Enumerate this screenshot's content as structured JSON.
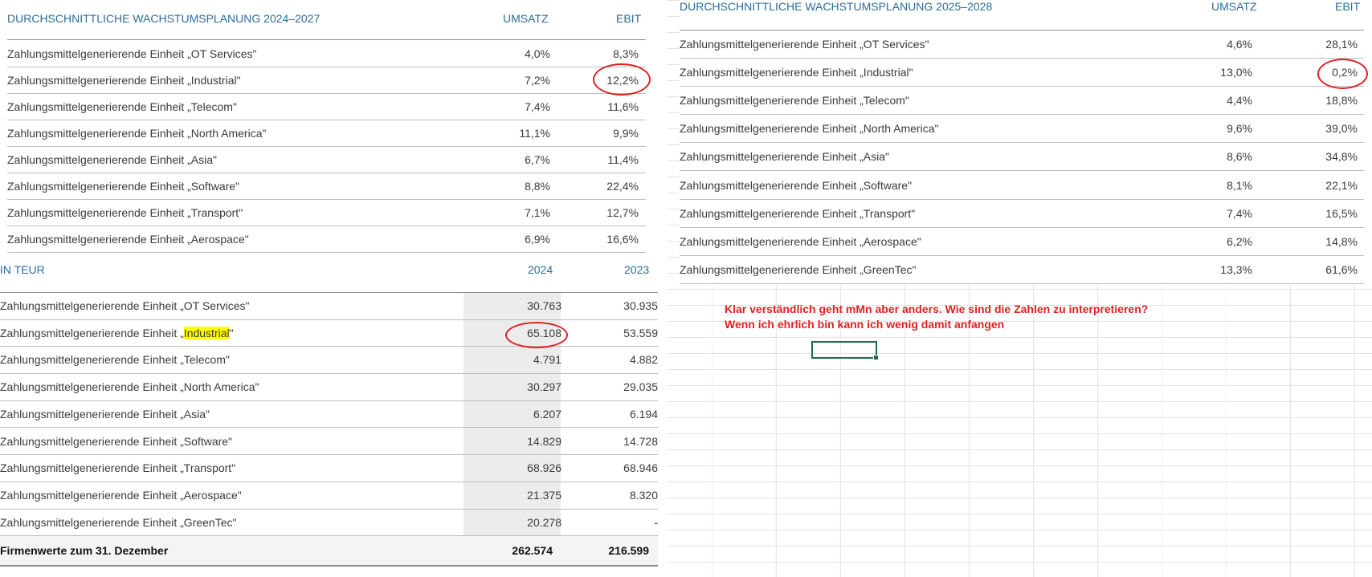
{
  "table_2024": {
    "header": {
      "title": "DURCHSCHNITTLICHE WACHSTUMSPLANUNG 2024–2027",
      "col1": "UMSATZ",
      "col2": "EBIT"
    },
    "rows": [
      {
        "label": "Zahlungsmittelgenerierende Einheit „OT Services\"",
        "umsatz": "4,0%",
        "ebit": "8,3%"
      },
      {
        "label": "Zahlungsmittelgenerierende Einheit „Industrial\"",
        "umsatz": "7,2%",
        "ebit": "12,2%"
      },
      {
        "label": "Zahlungsmittelgenerierende Einheit „Telecom\"",
        "umsatz": "7,4%",
        "ebit": "11,6%"
      },
      {
        "label": "Zahlungsmittelgenerierende Einheit „North America\"",
        "umsatz": "11,1%",
        "ebit": "9,9%"
      },
      {
        "label": "Zahlungsmittelgenerierende Einheit „Asia\"",
        "umsatz": "6,7%",
        "ebit": "11,4%"
      },
      {
        "label": "Zahlungsmittelgenerierende Einheit „Software\"",
        "umsatz": "8,8%",
        "ebit": "22,4%"
      },
      {
        "label": "Zahlungsmittelgenerierende Einheit „Transport\"",
        "umsatz": "7,1%",
        "ebit": "12,7%"
      },
      {
        "label": "Zahlungsmittelgenerierende Einheit „Aerospace\"",
        "umsatz": "6,9%",
        "ebit": "16,6%"
      }
    ]
  },
  "table_goodwill": {
    "header": {
      "title": "IN TEUR",
      "col1": "2024",
      "col2": "2023"
    },
    "rows": [
      {
        "label": "Zahlungsmittelgenerierende Einheit „OT Services\"",
        "v2024": "30.763",
        "v2023": "30.935"
      },
      {
        "label_pre": "Zahlungsmittelgenerierende Einheit „",
        "label_hl": "Industrial",
        "label_post": "\"",
        "v2024": "65.108",
        "v2023": "53.559"
      },
      {
        "label": "Zahlungsmittelgenerierende Einheit „Telecom\"",
        "v2024": "4.791",
        "v2023": "4.882"
      },
      {
        "label": "Zahlungsmittelgenerierende Einheit „North America\"",
        "v2024": "30.297",
        "v2023": "29.035"
      },
      {
        "label": "Zahlungsmittelgenerierende Einheit „Asia\"",
        "v2024": "6.207",
        "v2023": "6.194"
      },
      {
        "label": "Zahlungsmittelgenerierende Einheit „Software\"",
        "v2024": "14.829",
        "v2023": "14.728"
      },
      {
        "label": "Zahlungsmittelgenerierende Einheit „Transport\"",
        "v2024": "68.926",
        "v2023": "68.946"
      },
      {
        "label": "Zahlungsmittelgenerierende Einheit „Aerospace\"",
        "v2024": "21.375",
        "v2023": "8.320"
      },
      {
        "label": "Zahlungsmittelgenerierende Einheit „GreenTec\"",
        "v2024": "20.278",
        "v2023": "-"
      }
    ],
    "total": {
      "label": "Firmenwerte zum 31. Dezember",
      "v2024": "262.574",
      "v2023": "216.599"
    }
  },
  "table_2025": {
    "header": {
      "title": "DURCHSCHNITTLICHE WACHSTUMSPLANUNG 2025–2028",
      "col1": "UMSATZ",
      "col2": "EBIT"
    },
    "rows": [
      {
        "label": "Zahlungsmittelgenerierende Einheit „OT Services\"",
        "umsatz": "4,6%",
        "ebit": "28,1%"
      },
      {
        "label": "Zahlungsmittelgenerierende Einheit „Industrial\"",
        "umsatz": "13,0%",
        "ebit": "0,2%"
      },
      {
        "label": "Zahlungsmittelgenerierende Einheit „Telecom\"",
        "umsatz": "4,4%",
        "ebit": "18,8%"
      },
      {
        "label": "Zahlungsmittelgenerierende Einheit „North America\"",
        "umsatz": "9,6%",
        "ebit": "39,0%"
      },
      {
        "label": "Zahlungsmittelgenerierende Einheit „Asia\"",
        "umsatz": "8,6%",
        "ebit": "34,8%"
      },
      {
        "label": "Zahlungsmittelgenerierende Einheit „Software\"",
        "umsatz": "8,1%",
        "ebit": "22,1%"
      },
      {
        "label": "Zahlungsmittelgenerierende Einheit „Transport\"",
        "umsatz": "7,4%",
        "ebit": "16,5%"
      },
      {
        "label": "Zahlungsmittelgenerierende Einheit „Aerospace\"",
        "umsatz": "6,2%",
        "ebit": "14,8%"
      },
      {
        "label": "Zahlungsmittelgenerierende Einheit „GreenTec\"",
        "umsatz": "13,3%",
        "ebit": "61,6%"
      }
    ]
  },
  "comment": {
    "line1": "Klar verständlich geht mMn aber anders. Wie sind die Zahlen zu interpretieren?",
    "line2": "Wenn ich ehrlich bin kann ich wenig damit anfangen"
  },
  "colors": {
    "header_blue": "#2b6b9a",
    "annotation_red": "#e02020",
    "highlight_yellow": "#ffff00",
    "active_cell_green": "#1f6e43"
  }
}
